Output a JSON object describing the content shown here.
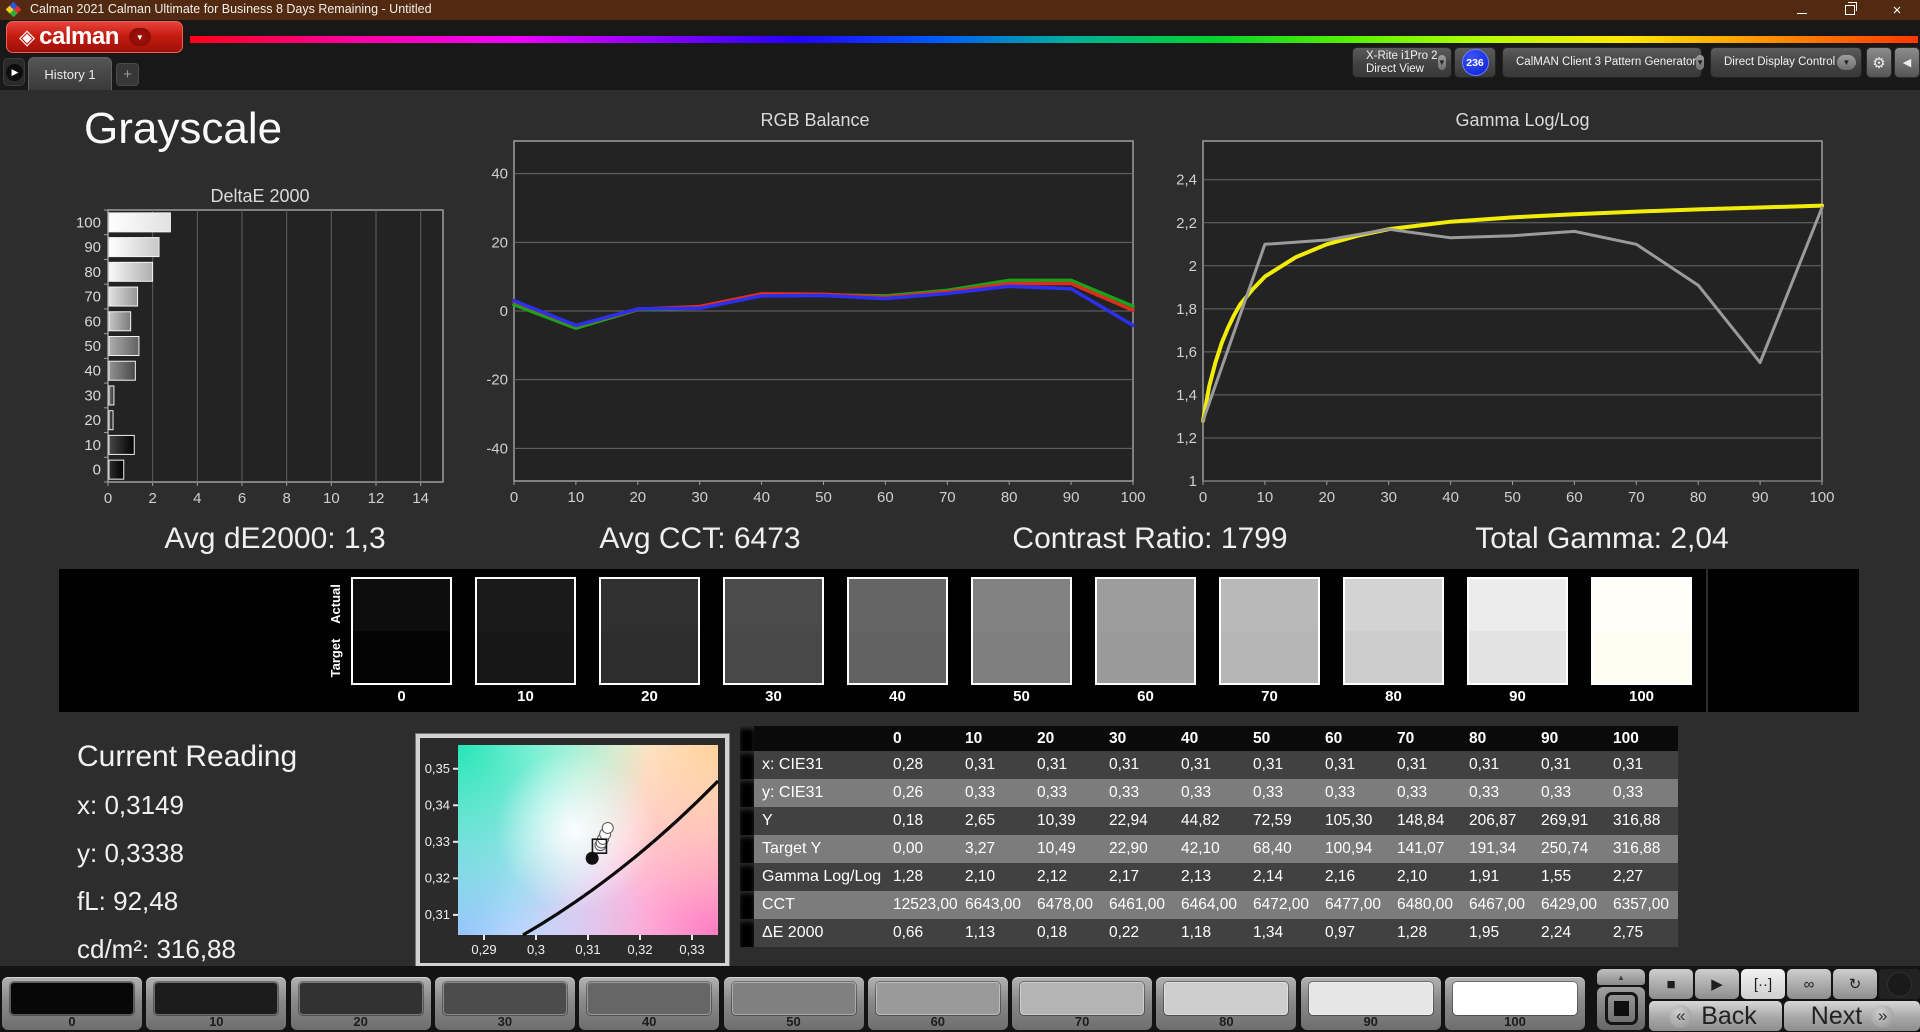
{
  "window": {
    "title": "Calman 2021 Calman Ultimate for Business 8 Days Remaining  - Untitled",
    "close_glyph": "×"
  },
  "brand": {
    "logo_glyph": "◈",
    "logo_text": "calman",
    "caret_glyph": "▼"
  },
  "tab_bar": {
    "nav_glyph": "▶",
    "history_tab": "History 1",
    "add_button": "+"
  },
  "device_toolbar": {
    "meter": {
      "line1": "X-Rite i1Pro 2",
      "line2": "Direct View",
      "accent": "#35c41c",
      "caret": "▼"
    },
    "meter_badge": "236",
    "pattern_source": {
      "label": "CalMAN Client 3 Pattern Generator",
      "accent": "#35c41c",
      "caret": "▼"
    },
    "display_control": {
      "label": "Direct Display Control",
      "accent": "#e3d81f",
      "caret": "▼"
    },
    "settings_glyph": "⚙",
    "collapse_glyph": "◀"
  },
  "page": {
    "title": "Grayscale"
  },
  "summary": {
    "avg_de2000": "Avg dE2000: 1,3",
    "avg_cct": "Avg CCT: 6473",
    "contrast_ratio": "Contrast Ratio: 1799",
    "total_gamma": "Total Gamma: 2,04"
  },
  "chart_data": [
    {
      "type": "bar",
      "title": "DeltaE 2000",
      "orientation": "horizontal",
      "categories": [
        100,
        90,
        80,
        70,
        60,
        50,
        40,
        30,
        20,
        10,
        0
      ],
      "values": [
        2.75,
        2.24,
        1.95,
        1.28,
        0.97,
        1.34,
        1.18,
        0.22,
        0.18,
        1.13,
        0.66
      ],
      "xlim": [
        0,
        15
      ],
      "xticks": [
        0,
        2,
        4,
        6,
        8,
        10,
        12,
        14
      ],
      "bar_fill": "grayscale-by-level",
      "grid": "vertical"
    },
    {
      "type": "line",
      "title": "RGB Balance",
      "x": [
        0,
        10,
        20,
        30,
        40,
        50,
        60,
        70,
        80,
        90,
        100
      ],
      "xlim": [
        0,
        100
      ],
      "ylim": [
        -49.5,
        49.5
      ],
      "yticks": [
        40,
        20,
        0,
        -20,
        -40
      ],
      "ytick_labels": [
        "40",
        "20",
        "0",
        "-20",
        "-40"
      ],
      "xticks": [
        0,
        10,
        20,
        30,
        40,
        50,
        60,
        70,
        80,
        90,
        100
      ],
      "series": [
        {
          "name": "Green",
          "color": "#17a517",
          "width": 3.5,
          "values": [
            1.8,
            -5.0,
            0.4,
            0.9,
            4.6,
            4.7,
            4.4,
            6.0,
            8.9,
            8.9,
            1.4
          ]
        },
        {
          "name": "Red",
          "color": "#dd2d1e",
          "width": 3.5,
          "values": [
            2.8,
            -4.3,
            0.5,
            1.3,
            5.0,
            4.9,
            4.0,
            5.6,
            8.0,
            8.0,
            0.2
          ]
        },
        {
          "name": "Blue",
          "color": "#2a30ee",
          "width": 3.5,
          "values": [
            3.0,
            -4.2,
            0.6,
            0.8,
            4.4,
            4.5,
            3.6,
            5.1,
            7.2,
            6.5,
            -4.2
          ]
        }
      ]
    },
    {
      "type": "line",
      "title": "Gamma Log/Log",
      "xlim": [
        0,
        100
      ],
      "ylim": [
        1.0,
        2.58
      ],
      "yticks": [
        2.4,
        2.2,
        2.0,
        1.8,
        1.6,
        1.4,
        1.2,
        1.0
      ],
      "ytick_labels": [
        "2,4",
        "2,2",
        "2",
        "1,8",
        "1,6",
        "1,4",
        "1,2",
        "1"
      ],
      "xticks": [
        0,
        10,
        20,
        30,
        40,
        50,
        60,
        70,
        80,
        90,
        100
      ],
      "series": [
        {
          "name": "Target Gamma",
          "color": "#f1ec08",
          "width": 4,
          "x": [
            0,
            1,
            2,
            3,
            4,
            5,
            6,
            8,
            10,
            15,
            20,
            25,
            30,
            40,
            50,
            60,
            70,
            80,
            90,
            100
          ],
          "values": [
            1.28,
            1.44,
            1.55,
            1.64,
            1.71,
            1.77,
            1.82,
            1.89,
            1.95,
            2.04,
            2.1,
            2.14,
            2.17,
            2.205,
            2.225,
            2.24,
            2.252,
            2.262,
            2.271,
            2.28
          ]
        },
        {
          "name": "Measured Gamma",
          "color": "#9b9b9b",
          "width": 3,
          "x": [
            0,
            10,
            20,
            30,
            40,
            50,
            60,
            70,
            80,
            90,
            100
          ],
          "values": [
            1.28,
            2.1,
            2.12,
            2.17,
            2.13,
            2.14,
            2.16,
            2.1,
            1.91,
            1.55,
            2.27
          ]
        }
      ]
    },
    {
      "type": "scatter",
      "title": "CIE 1931 xy",
      "xlim": [
        0.285,
        0.335
      ],
      "ylim": [
        0.3045,
        0.3565
      ],
      "xticks": [
        0.29,
        0.3,
        0.31,
        0.32,
        0.33
      ],
      "xtick_labels": [
        "0,29",
        "0,3",
        "0,31",
        "0,32",
        "0,33"
      ],
      "yticks": [
        0.35,
        0.34,
        0.33,
        0.32,
        0.31
      ],
      "ytick_labels": [
        "0,35",
        "0,34",
        "0,33",
        "0,32",
        "0,31"
      ],
      "measurements": [
        [
          0.3138,
          0.3338
        ],
        [
          0.3133,
          0.3321
        ],
        [
          0.3129,
          0.3308
        ],
        [
          0.3126,
          0.3298
        ],
        [
          0.3124,
          0.3291
        ]
      ],
      "target_point": [
        0.3122,
        0.3288
      ],
      "current_point": [
        0.3108,
        0.3255
      ]
    }
  ],
  "grayscale_strip": {
    "row_labels": [
      "Actual",
      "Target"
    ],
    "levels": [
      "0",
      "10",
      "20",
      "30",
      "40",
      "50",
      "60",
      "70",
      "80",
      "90",
      "100"
    ],
    "actual_colors": [
      "#0d0d0d",
      "#1a1a1a",
      "#303030",
      "#4b4b4b",
      "#656565",
      "#828282",
      "#9d9d9d",
      "#b9b9b9",
      "#d3d3d3",
      "#ececec",
      "#fffef8"
    ],
    "target_colors": [
      "#040404",
      "#171717",
      "#2d2d2d",
      "#484848",
      "#626262",
      "#7f7f7f",
      "#9a9a9a",
      "#b6b6b6",
      "#cdcdcd",
      "#e3e3e3",
      "#fffdf2"
    ]
  },
  "current_reading": {
    "title": "Current Reading",
    "lines": [
      {
        "label": "x:",
        "value": "0,3149"
      },
      {
        "label": "y:",
        "value": "0,3338"
      },
      {
        "label": "fL:",
        "value": "92,48"
      },
      {
        "label": "cd/m²:",
        "value": "316,88"
      }
    ]
  },
  "results_table": {
    "columns": [
      "0",
      "10",
      "20",
      "30",
      "40",
      "50",
      "60",
      "70",
      "80",
      "90",
      "100"
    ],
    "rows": [
      {
        "label": "x: CIE31",
        "shade": "dark",
        "values": [
          "0,28",
          "0,31",
          "0,31",
          "0,31",
          "0,31",
          "0,31",
          "0,31",
          "0,31",
          "0,31",
          "0,31",
          "0,31"
        ]
      },
      {
        "label": "y: CIE31",
        "shade": "light",
        "values": [
          "0,26",
          "0,33",
          "0,33",
          "0,33",
          "0,33",
          "0,33",
          "0,33",
          "0,33",
          "0,33",
          "0,33",
          "0,33"
        ]
      },
      {
        "label": "Y",
        "shade": "dark",
        "values": [
          "0,18",
          "2,65",
          "10,39",
          "22,94",
          "44,82",
          "72,59",
          "105,30",
          "148,84",
          "206,87",
          "269,91",
          "316,88"
        ]
      },
      {
        "label": "Target Y",
        "shade": "light",
        "values": [
          "0,00",
          "3,27",
          "10,49",
          "22,90",
          "42,10",
          "68,40",
          "100,94",
          "141,07",
          "191,34",
          "250,74",
          "316,88"
        ]
      },
      {
        "label": "Gamma Log/Log",
        "shade": "dark",
        "values": [
          "1,28",
          "2,10",
          "2,12",
          "2,17",
          "2,13",
          "2,14",
          "2,16",
          "2,10",
          "1,91",
          "1,55",
          "2,27"
        ]
      },
      {
        "label": "CCT",
        "shade": "light",
        "values": [
          "12523,00",
          "6643,00",
          "6478,00",
          "6461,00",
          "6464,00",
          "6472,00",
          "6477,00",
          "6480,00",
          "6467,00",
          "6429,00",
          "6357,00"
        ]
      },
      {
        "label": "ΔE 2000",
        "shade": "dark",
        "values": [
          "0,66",
          "1,13",
          "0,18",
          "0,22",
          "1,18",
          "1,34",
          "0,97",
          "1,28",
          "1,95",
          "2,24",
          "2,75"
        ]
      }
    ]
  },
  "bottom_bar": {
    "patches": [
      {
        "label": "0",
        "color": "#070707"
      },
      {
        "label": "10",
        "color": "#1c1c1c"
      },
      {
        "label": "20",
        "color": "#323232"
      },
      {
        "label": "30",
        "color": "#4c4c4c"
      },
      {
        "label": "40",
        "color": "#666666"
      },
      {
        "label": "50",
        "color": "#808080"
      },
      {
        "label": "60",
        "color": "#9a9a9a"
      },
      {
        "label": "70",
        "color": "#b4b4b4"
      },
      {
        "label": "80",
        "color": "#cecece"
      },
      {
        "label": "90",
        "color": "#e6e6e6"
      },
      {
        "label": "100",
        "color": "#ffffff"
      }
    ],
    "up_glyph": "▲",
    "transport": [
      {
        "name": "stop",
        "glyph": "■",
        "active": false
      },
      {
        "name": "play",
        "glyph": "▶",
        "active": false
      },
      {
        "name": "pattern-window",
        "glyph": "[··]",
        "active": true
      },
      {
        "name": "continuous",
        "glyph": "∞",
        "active": false
      },
      {
        "name": "refresh",
        "glyph": "↻",
        "active": false
      }
    ],
    "back": {
      "chevron": "«",
      "label": "Back"
    },
    "next": {
      "chevron": "»",
      "label": "Next"
    }
  }
}
